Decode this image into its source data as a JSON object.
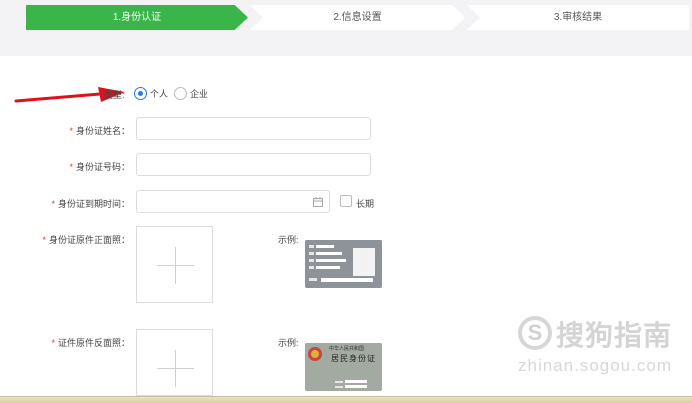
{
  "steps": [
    {
      "label": "1.身份认证",
      "active": true
    },
    {
      "label": "2.信息设置",
      "active": false
    },
    {
      "label": "3.审核结果",
      "active": false
    }
  ],
  "form": {
    "type_label": "类型:",
    "type_options": [
      {
        "label": "个人",
        "checked": true
      },
      {
        "label": "企业",
        "checked": false
      }
    ],
    "required_mark": "*",
    "name_label": "身份证姓名：",
    "name_value": "",
    "id_label": "身份证号码：",
    "id_value": "",
    "expiry_label": "身份证到期时间：",
    "expiry_value": "",
    "long_term_label": "长期",
    "front_label": "身份证原件正面照：",
    "back_label": "证件原件反面照：",
    "sample_label": "示例:",
    "back_sample_title": "中华人民共和国",
    "back_sample_subtitle": "居民身份证"
  },
  "watermark": {
    "brand": "搜狗指南",
    "url": "zhinan.sogou.com"
  },
  "colors": {
    "active_step": "#39b54a",
    "required": "#e6372f",
    "radio_accent": "#2b78e4",
    "arrow": "#d9141b"
  }
}
